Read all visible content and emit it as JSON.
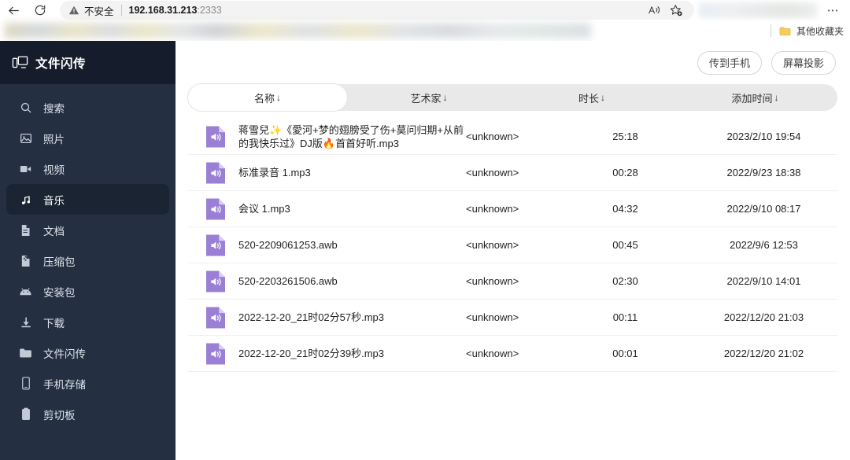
{
  "browser": {
    "back_icon": "back-arrow-icon",
    "reload_icon": "reload-icon",
    "security_label": "不安全",
    "url_host": "192.168.31.213",
    "url_port": ":2333",
    "read_aloud_icon": "read-aloud-icon",
    "favorites_icon": "add-favorite-icon",
    "more_icon": "more-options-icon",
    "more_glyph": "⋯",
    "bookmarks": {
      "other_favorites_label": "其他收藏夹",
      "folder_icon": "folder-icon"
    }
  },
  "sidebar": {
    "logo_icon": "phone-monitor-icon",
    "title": "文件闪传",
    "items": [
      {
        "label": "搜索",
        "icon": "search-icon",
        "active": false
      },
      {
        "label": "照片",
        "icon": "photo-icon",
        "active": false
      },
      {
        "label": "视频",
        "icon": "video-icon",
        "active": false
      },
      {
        "label": "音乐",
        "icon": "music-note-icon",
        "active": true
      },
      {
        "label": "文档",
        "icon": "document-icon",
        "active": false
      },
      {
        "label": "压缩包",
        "icon": "archive-icon",
        "active": false
      },
      {
        "label": "安装包",
        "icon": "android-icon",
        "active": false
      },
      {
        "label": "下载",
        "icon": "download-icon",
        "active": false
      },
      {
        "label": "文件闪传",
        "icon": "folder-icon",
        "active": false
      },
      {
        "label": "手机存储",
        "icon": "phone-icon",
        "active": false
      },
      {
        "label": "剪切板",
        "icon": "clipboard-icon",
        "active": false
      }
    ]
  },
  "toolbar": {
    "send_to_phone_label": "传到手机",
    "screen_cast_label": "屏幕投影"
  },
  "table": {
    "columns": [
      {
        "label": "名称",
        "sort": "↓",
        "active": true
      },
      {
        "label": "艺术家",
        "sort": "↓",
        "active": false
      },
      {
        "label": "时长",
        "sort": "↓",
        "active": false
      },
      {
        "label": "添加时间",
        "sort": "↓",
        "active": false
      }
    ],
    "file_icon": "audio-file-icon",
    "file_icon_color": "#9b7fd4",
    "rows": [
      {
        "name": "蒋雪兒✨《愛河+梦的翅膀受了伤+莫问归期+从前的我快乐过》DJ版🔥首首好听.mp3",
        "artist": "<unknown>",
        "duration": "25:18",
        "added": "2023/2/10 19:54"
      },
      {
        "name": "标准录音 1.mp3",
        "artist": "<unknown>",
        "duration": "00:28",
        "added": "2022/9/23 18:38"
      },
      {
        "name": "会议 1.mp3",
        "artist": "<unknown>",
        "duration": "04:32",
        "added": "2022/9/10 08:17"
      },
      {
        "name": "520-2209061253.awb",
        "artist": "<unknown>",
        "duration": "00:45",
        "added": "2022/9/6 12:53"
      },
      {
        "name": "520-2203261506.awb",
        "artist": "<unknown>",
        "duration": "02:30",
        "added": "2022/9/10 14:01"
      },
      {
        "name": "2022-12-20_21时02分57秒.mp3",
        "artist": "<unknown>",
        "duration": "00:11",
        "added": "2022/12/20 21:03"
      },
      {
        "name": "2022-12-20_21时02分39秒.mp3",
        "artist": "<unknown>",
        "duration": "00:01",
        "added": "2022/12/20 21:02"
      }
    ]
  },
  "colors": {
    "sidebar_bg": "#242f42",
    "sidebar_header_bg": "#151d2c",
    "sidebar_active_bg": "#1b2433",
    "accent_purple": "#9b7fd4",
    "table_head_bg": "#e9e9e9"
  }
}
